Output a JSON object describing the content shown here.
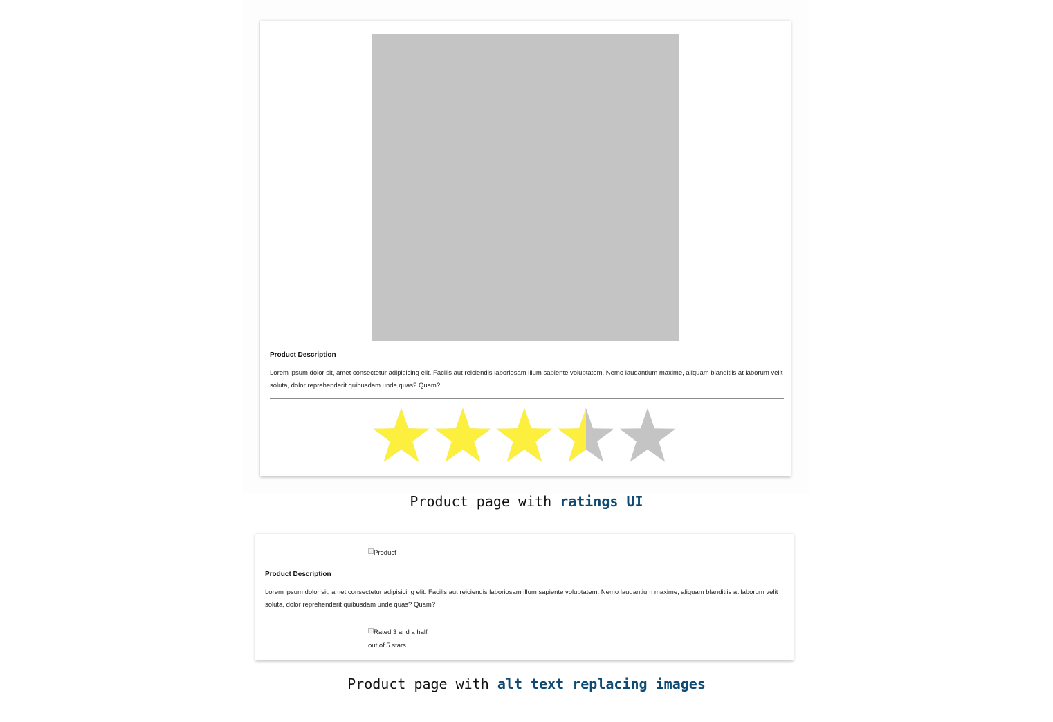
{
  "panel_ratings": {
    "heading": "Product Description",
    "description": "Lorem ipsum dolor sit, amet consectetur adipisicing elit. Facilis aut reiciendis laboriosam illum sapiente voluptatem. Nemo laudantium maxime, aliquam blanditiis at laborum velit soluta, dolor reprehenderit quibusdam unde quas? Quam?",
    "rating": 3.5,
    "rating_max": 5,
    "star_filled_color": "#fcef3d",
    "star_empty_color": "#c4c4c4",
    "image_placeholder_color": "#c4c4c4"
  },
  "caption1": {
    "prefix": "Product page with ",
    "highlight": "ratings UI"
  },
  "panel_alt": {
    "image_alt": "Product",
    "heading": "Product Description",
    "description": "Lorem ipsum dolor sit, amet consectetur adipisicing elit. Facilis aut reiciendis laboriosam illum sapiente voluptatem. Nemo laudantium maxime, aliquam blanditiis at laborum velit soluta, dolor reprehenderit quibusdam unde quas? Quam?",
    "rating_alt": "Rated 3 and a half out of 5 stars"
  },
  "caption2": {
    "prefix": "Product page with ",
    "highlight": "alt text replacing images"
  },
  "colors": {
    "caption_highlight": "#0e4a73"
  }
}
